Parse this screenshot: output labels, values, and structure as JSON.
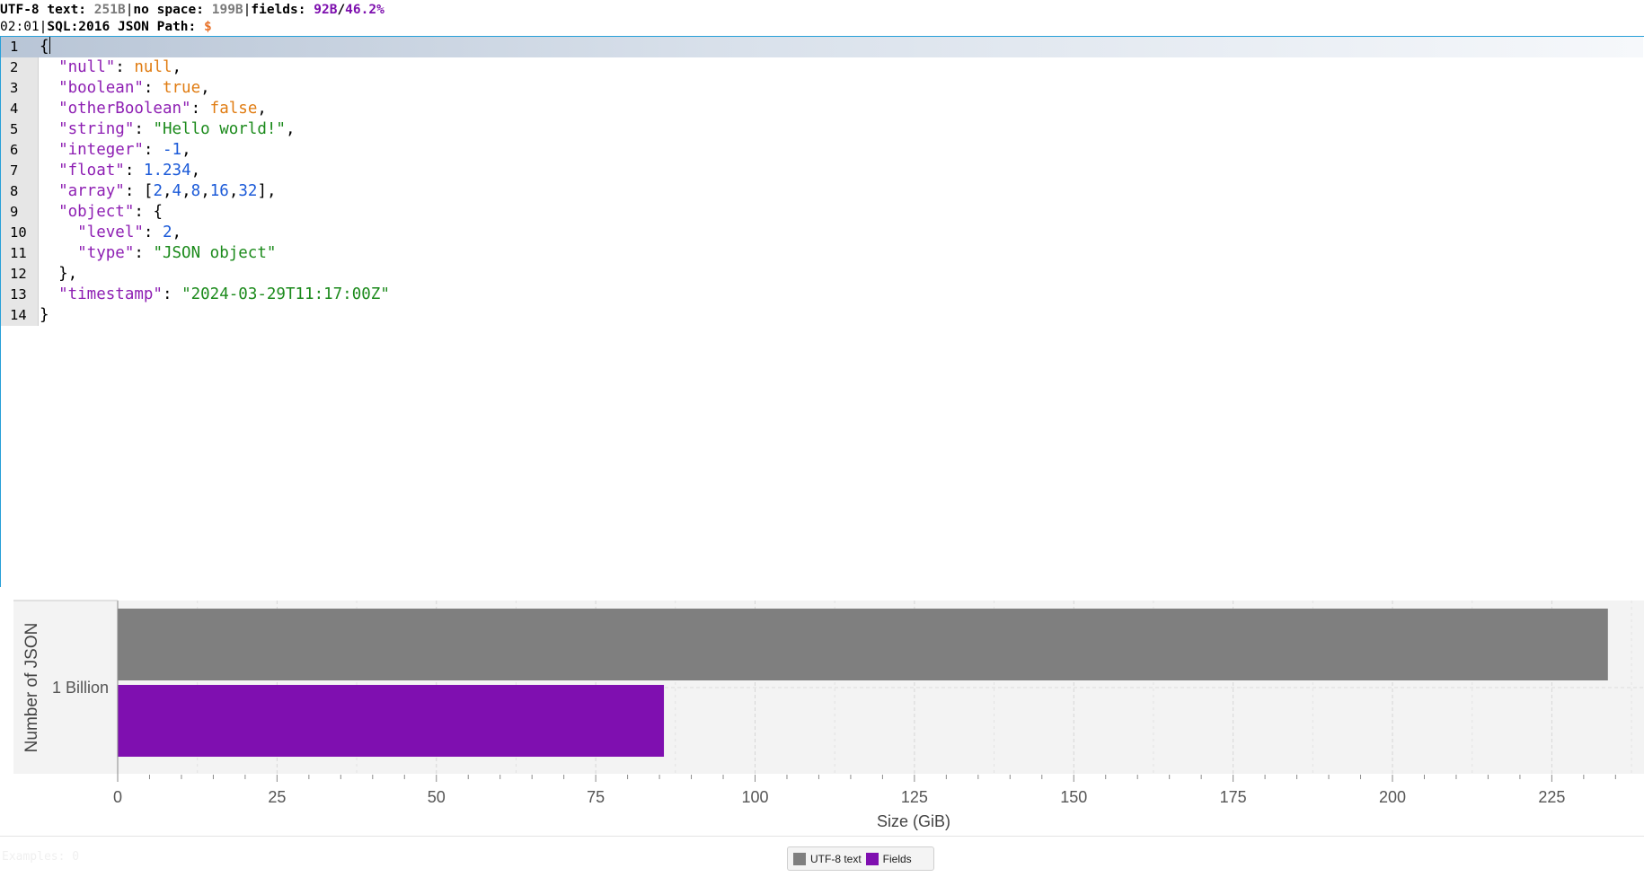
{
  "status": {
    "utf8_label": "UTF-8 text: ",
    "utf8_value": "251B",
    "nospace_label": "no space: ",
    "nospace_value": "199B",
    "fields_label": "fields: ",
    "fields_value": "92B",
    "fields_slash": "/",
    "fields_percent": "46.2%",
    "cursor_pos": "02:01",
    "path_label": "SQL:2016 JSON Path: ",
    "path_value": "$"
  },
  "editor": {
    "current_line": 1,
    "lines": [
      [
        {
          "t": "{",
          "c": "p"
        }
      ],
      [
        {
          "t": "  ",
          "c": "p"
        },
        {
          "t": "\"null\"",
          "c": "k"
        },
        {
          "t": ": ",
          "c": "p"
        },
        {
          "t": "null",
          "c": "b"
        },
        {
          "t": ",",
          "c": "p"
        }
      ],
      [
        {
          "t": "  ",
          "c": "p"
        },
        {
          "t": "\"boolean\"",
          "c": "k"
        },
        {
          "t": ": ",
          "c": "p"
        },
        {
          "t": "true",
          "c": "b"
        },
        {
          "t": ",",
          "c": "p"
        }
      ],
      [
        {
          "t": "  ",
          "c": "p"
        },
        {
          "t": "\"otherBoolean\"",
          "c": "k"
        },
        {
          "t": ": ",
          "c": "p"
        },
        {
          "t": "false",
          "c": "b"
        },
        {
          "t": ",",
          "c": "p"
        }
      ],
      [
        {
          "t": "  ",
          "c": "p"
        },
        {
          "t": "\"string\"",
          "c": "k"
        },
        {
          "t": ": ",
          "c": "p"
        },
        {
          "t": "\"Hello world!\"",
          "c": "s"
        },
        {
          "t": ",",
          "c": "p"
        }
      ],
      [
        {
          "t": "  ",
          "c": "p"
        },
        {
          "t": "\"integer\"",
          "c": "k"
        },
        {
          "t": ": ",
          "c": "p"
        },
        {
          "t": "-1",
          "c": "n"
        },
        {
          "t": ",",
          "c": "p"
        }
      ],
      [
        {
          "t": "  ",
          "c": "p"
        },
        {
          "t": "\"float\"",
          "c": "k"
        },
        {
          "t": ": ",
          "c": "p"
        },
        {
          "t": "1.234",
          "c": "n"
        },
        {
          "t": ",",
          "c": "p"
        }
      ],
      [
        {
          "t": "  ",
          "c": "p"
        },
        {
          "t": "\"array\"",
          "c": "k"
        },
        {
          "t": ": [",
          "c": "p"
        },
        {
          "t": "2",
          "c": "n"
        },
        {
          "t": ",",
          "c": "p"
        },
        {
          "t": "4",
          "c": "n"
        },
        {
          "t": ",",
          "c": "p"
        },
        {
          "t": "8",
          "c": "n"
        },
        {
          "t": ",",
          "c": "p"
        },
        {
          "t": "16",
          "c": "n"
        },
        {
          "t": ",",
          "c": "p"
        },
        {
          "t": "32",
          "c": "n"
        },
        {
          "t": "],",
          "c": "p"
        }
      ],
      [
        {
          "t": "  ",
          "c": "p"
        },
        {
          "t": "\"object\"",
          "c": "k"
        },
        {
          "t": ": {",
          "c": "p"
        }
      ],
      [
        {
          "t": "    ",
          "c": "p"
        },
        {
          "t": "\"level\"",
          "c": "k"
        },
        {
          "t": ": ",
          "c": "p"
        },
        {
          "t": "2",
          "c": "n"
        },
        {
          "t": ",",
          "c": "p"
        }
      ],
      [
        {
          "t": "    ",
          "c": "p"
        },
        {
          "t": "\"type\"",
          "c": "k"
        },
        {
          "t": ": ",
          "c": "p"
        },
        {
          "t": "\"JSON object\"",
          "c": "s"
        }
      ],
      [
        {
          "t": "  },",
          "c": "p"
        }
      ],
      [
        {
          "t": "  ",
          "c": "p"
        },
        {
          "t": "\"timestamp\"",
          "c": "k"
        },
        {
          "t": ": ",
          "c": "p"
        },
        {
          "t": "\"2024-03-29T11:17:00Z\"",
          "c": "s"
        }
      ],
      [
        {
          "t": "}",
          "c": "p"
        }
      ]
    ]
  },
  "chart_data": {
    "type": "bar",
    "orientation": "horizontal",
    "categories": [
      "1 Billion"
    ],
    "series": [
      {
        "name": "UTF-8 text",
        "values": [
          233.8
        ],
        "color": "#7f7f7f"
      },
      {
        "name": "Fields",
        "values": [
          85.7
        ],
        "color": "#7f0fb0"
      }
    ],
    "xlabel": "Size (GiB)",
    "ylabel": "Number of JSON",
    "xlim": [
      0,
      240
    ],
    "xticks": [
      "0",
      "25",
      "50",
      "75",
      "100",
      "125",
      "150",
      "175",
      "200",
      "225"
    ],
    "grid": true,
    "legend_position": "bottom"
  },
  "footer": {
    "examples_text": "Examples: 0"
  }
}
